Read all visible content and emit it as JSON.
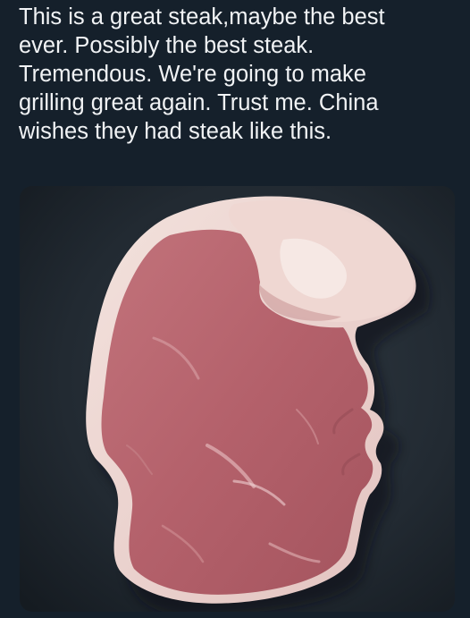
{
  "post": {
    "caption_lines": [
      "This is a great steak,maybe the best",
      "ever. Possibly the best steak.",
      "Tremendous. We're going to make",
      "grilling great again. Trust me. China",
      "wishes they had steak like this."
    ]
  },
  "image": {
    "subject": "steak",
    "colors": {
      "background": "#15202b",
      "meat": "#b86670",
      "fat": "#eed8d3"
    }
  }
}
